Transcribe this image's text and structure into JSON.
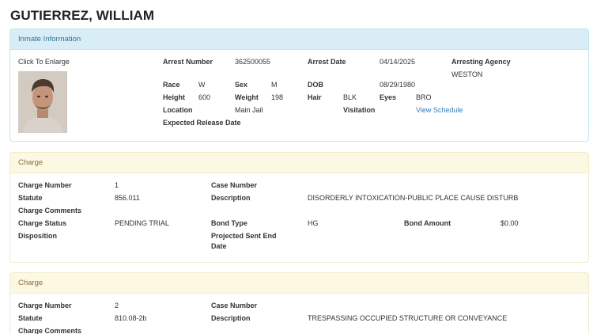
{
  "name": "GUTIERREZ, WILLIAM",
  "info": {
    "heading": "Inmate Information",
    "enlarge": "Click To Enlarge",
    "arrest_number_label": "Arrest Number",
    "arrest_number": "362500055",
    "arrest_date_label": "Arrest Date",
    "arrest_date": "04/14/2025",
    "agency_label": "Arresting Agency",
    "agency": "WESTON",
    "race_label": "Race",
    "race": "W",
    "sex_label": "Sex",
    "sex": "M",
    "dob_label": "DOB",
    "dob": "08/29/1980",
    "height_label": "Height",
    "height": "600",
    "weight_label": "Weight",
    "weight": "198",
    "hair_label": "Hair",
    "hair": "BLK",
    "eyes_label": "Eyes",
    "eyes": "BRO",
    "location_label": "Location",
    "location": "Main Jail",
    "visitation_label": "Visitation",
    "visitation_link": "View Schedule",
    "release_label": "Expected Release Date"
  },
  "charges": [
    {
      "heading": "Charge",
      "number_label": "Charge Number",
      "number": "1",
      "case_label": "Case Number",
      "statute_label": "Statute",
      "statute": "856.011",
      "desc_label": "Description",
      "desc": "DISORDERLY INTOXICATION-PUBLIC PLACE CAUSE DISTURB",
      "comments_label": "Charge Comments",
      "status_label": "Charge Status",
      "status": "PENDING TRIAL",
      "bond_type_label": "Bond Type",
      "bond_type": "HG",
      "bond_amount_label": "Bond Amount",
      "bond_amount": "$0.00",
      "disposition_label": "Disposition",
      "sent_end_label_1": "Projected Sent End",
      "sent_end_label_2": "Date"
    },
    {
      "heading": "Charge",
      "number_label": "Charge Number",
      "number": "2",
      "case_label": "Case Number",
      "statute_label": "Statute",
      "statute": "810.08-2b",
      "desc_label": "Description",
      "desc": "TRESPASSING OCCUPIED STRUCTURE OR CONVEYANCE",
      "comments_label": "Charge Comments"
    }
  ]
}
